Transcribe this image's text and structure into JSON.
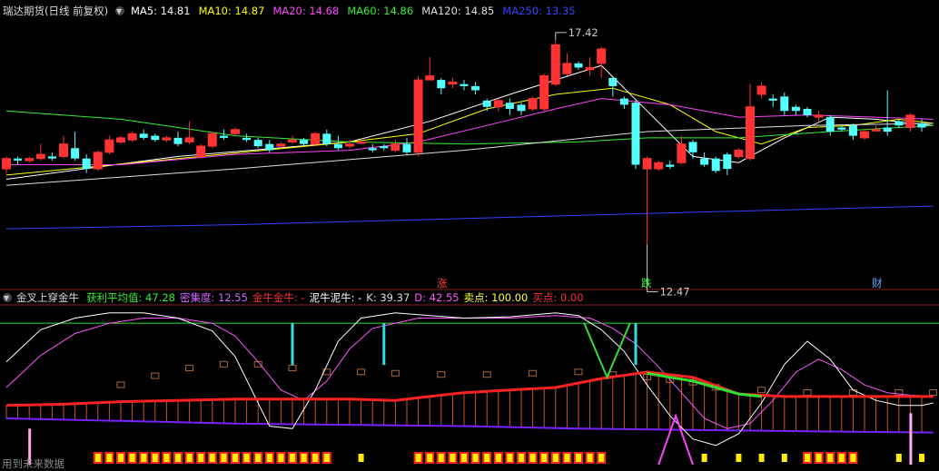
{
  "main": {
    "title": "瑞达期货(日线 前复权)",
    "ma_legend": [
      {
        "label": "MA5: 14.81",
        "color": "#ffffff"
      },
      {
        "label": "MA10: 14.87",
        "color": "#ffff00"
      },
      {
        "label": "MA20: 14.68",
        "color": "#ff44ff"
      },
      {
        "label": "MA60: 14.86",
        "color": "#33ee33"
      },
      {
        "label": "MA120: 14.85",
        "color": "#dddddd"
      },
      {
        "label": "MA250: 13.35",
        "color": "#3344ff"
      }
    ],
    "high_marker": "17.42",
    "low_marker": "12.47",
    "event_labels": [
      {
        "text": "涨",
        "color": "#ff4444"
      },
      {
        "text": "跌",
        "color": "#44ff44"
      },
      {
        "text": "财",
        "color": "#66aaff"
      }
    ]
  },
  "indicator": {
    "title": "金叉上穿金牛",
    "legend": [
      {
        "label": "获利平均值: 47.28",
        "color": "#33ee33"
      },
      {
        "label": "密集度: 12.55",
        "color": "#cc66ff"
      },
      {
        "label": "金牛金牛: -",
        "color": "#ff3333"
      },
      {
        "label": "泥牛泥牛: -",
        "color": "#ffffff"
      },
      {
        "label": "K: 39.37",
        "color": "#dddddd"
      },
      {
        "label": "D: 42.55",
        "color": "#ff55ff"
      },
      {
        "label": "卖点: 100.00",
        "color": "#ffff33"
      },
      {
        "label": "买点: 0.00",
        "color": "#ff3333"
      }
    ],
    "footer": "用到未来数据"
  },
  "chart_data": {
    "type": "candlestick",
    "ylim": [
      11.8,
      17.9
    ],
    "candles": [
      [
        14.3,
        14.55,
        14.2,
        14.6
      ],
      [
        14.55,
        14.5,
        14.4,
        14.6
      ],
      [
        14.5,
        14.55,
        14.45,
        14.6
      ],
      [
        14.55,
        14.65,
        14.5,
        14.9
      ],
      [
        14.6,
        14.55,
        14.5,
        14.7
      ],
      [
        14.6,
        14.9,
        14.55,
        15.1
      ],
      [
        14.8,
        14.55,
        14.5,
        15.2
      ],
      [
        14.55,
        14.3,
        14.2,
        14.65
      ],
      [
        14.3,
        14.7,
        14.25,
        14.75
      ],
      [
        14.7,
        15.0,
        14.65,
        15.1
      ],
      [
        14.95,
        15.05,
        14.9,
        15.1
      ],
      [
        15.0,
        15.15,
        14.95,
        15.2
      ],
      [
        15.15,
        15.05,
        15.0,
        15.25
      ],
      [
        15.1,
        15.0,
        14.95,
        15.15
      ],
      [
        15.0,
        15.05,
        14.95,
        15.1
      ],
      [
        15.05,
        14.9,
        14.85,
        15.2
      ],
      [
        14.95,
        15.05,
        14.9,
        15.45
      ],
      [
        14.6,
        14.85,
        14.55,
        14.9
      ],
      [
        14.85,
        15.15,
        14.8,
        15.2
      ],
      [
        15.1,
        15.05,
        15.0,
        15.25
      ],
      [
        15.15,
        15.25,
        15.1,
        15.3
      ],
      [
        15.05,
        15.0,
        14.95,
        15.15
      ],
      [
        15.0,
        14.85,
        14.8,
        15.05
      ],
      [
        14.9,
        14.75,
        14.7,
        15.0
      ],
      [
        14.85,
        14.9,
        14.8,
        14.95
      ],
      [
        14.95,
        15.0,
        14.9,
        15.1
      ],
      [
        15.0,
        14.9,
        14.85,
        15.05
      ],
      [
        14.9,
        15.15,
        14.85,
        15.2
      ],
      [
        15.15,
        14.9,
        14.85,
        15.25
      ],
      [
        14.9,
        14.8,
        14.75,
        15.1
      ],
      [
        14.85,
        14.9,
        14.8,
        15.0
      ],
      [
        14.95,
        14.95,
        14.9,
        15.0
      ],
      [
        14.8,
        14.75,
        14.7,
        14.9
      ],
      [
        14.85,
        14.8,
        14.75,
        14.9
      ],
      [
        14.75,
        14.9,
        14.7,
        15.0
      ],
      [
        14.9,
        14.7,
        14.65,
        15.05
      ],
      [
        14.7,
        16.45,
        14.6,
        16.55
      ],
      [
        16.45,
        16.55,
        16.45,
        17.0
      ],
      [
        16.45,
        16.25,
        16.1,
        16.5
      ],
      [
        16.35,
        16.4,
        16.25,
        16.5
      ],
      [
        16.35,
        16.3,
        16.2,
        16.45
      ],
      [
        16.3,
        16.2,
        16.1,
        16.4
      ],
      [
        15.95,
        15.8,
        15.7,
        16.0
      ],
      [
        15.8,
        15.95,
        15.7,
        16.0
      ],
      [
        15.9,
        15.75,
        15.6,
        16.0
      ],
      [
        15.85,
        15.7,
        15.6,
        15.9
      ],
      [
        15.75,
        16.0,
        15.7,
        16.05
      ],
      [
        15.75,
        16.55,
        15.7,
        16.6
      ],
      [
        16.35,
        17.3,
        16.3,
        17.42
      ],
      [
        16.6,
        16.85,
        16.55,
        17.1
      ],
      [
        16.85,
        16.75,
        16.7,
        16.9
      ],
      [
        16.7,
        16.75,
        16.55,
        17.0
      ],
      [
        16.85,
        17.2,
        16.5,
        17.25
      ],
      [
        16.5,
        16.3,
        16.05,
        16.5
      ],
      [
        16.0,
        15.85,
        15.75,
        16.05
      ],
      [
        15.9,
        14.4,
        14.3,
        15.95
      ],
      [
        14.3,
        14.55,
        12.47,
        14.6
      ],
      [
        14.3,
        14.45,
        14.25,
        14.5
      ],
      [
        14.4,
        14.35,
        14.3,
        14.5
      ],
      [
        14.45,
        14.9,
        14.4,
        15.1
      ],
      [
        14.95,
        14.7,
        14.55,
        15.0
      ],
      [
        14.55,
        14.4,
        14.35,
        14.7
      ],
      [
        14.55,
        14.25,
        14.2,
        14.6
      ],
      [
        14.65,
        14.3,
        14.15,
        14.7
      ],
      [
        14.6,
        14.75,
        14.55,
        14.8
      ],
      [
        14.55,
        15.8,
        14.5,
        16.35
      ],
      [
        16.1,
        16.3,
        16.0,
        16.4
      ],
      [
        16.0,
        15.95,
        15.8,
        16.1
      ],
      [
        16.05,
        15.7,
        15.6,
        16.15
      ],
      [
        15.8,
        15.7,
        15.6,
        15.85
      ],
      [
        15.75,
        15.6,
        15.55,
        15.8
      ],
      [
        15.55,
        15.6,
        15.45,
        15.7
      ],
      [
        15.55,
        15.2,
        15.1,
        15.6
      ],
      [
        15.3,
        15.25,
        15.2,
        15.35
      ],
      [
        15.35,
        15.1,
        15.0,
        15.4
      ],
      [
        15.05,
        15.2,
        15.0,
        15.25
      ],
      [
        15.25,
        15.25,
        15.2,
        15.35
      ],
      [
        15.3,
        15.2,
        15.1,
        16.2
      ],
      [
        15.45,
        15.35,
        15.3,
        15.5
      ],
      [
        15.3,
        15.6,
        15.2,
        15.65
      ],
      [
        15.4,
        15.3,
        15.2,
        15.5
      ]
    ],
    "ma_series": [
      {
        "name": "MA5",
        "color": "#ffffff",
        "points": [
          [
            0,
            14.05
          ],
          [
            15,
            14.6
          ],
          [
            30,
            14.95
          ],
          [
            37,
            15.45
          ],
          [
            44,
            16.1
          ],
          [
            48,
            16.45
          ],
          [
            52,
            16.8
          ],
          [
            56,
            15.7
          ],
          [
            60,
            14.6
          ],
          [
            64,
            14.45
          ],
          [
            68,
            15.05
          ],
          [
            72,
            15.55
          ],
          [
            76,
            15.5
          ],
          [
            81,
            15.35
          ]
        ]
      },
      {
        "name": "MA10",
        "color": "#ffff00",
        "points": [
          [
            0,
            14.15
          ],
          [
            15,
            14.55
          ],
          [
            30,
            14.95
          ],
          [
            36,
            15.15
          ],
          [
            42,
            15.75
          ],
          [
            48,
            16.1
          ],
          [
            53,
            16.25
          ],
          [
            58,
            15.85
          ],
          [
            62,
            15.2
          ],
          [
            66,
            14.9
          ],
          [
            70,
            15.3
          ],
          [
            74,
            15.35
          ],
          [
            78,
            15.5
          ],
          [
            81,
            15.4
          ]
        ]
      },
      {
        "name": "MA20",
        "color": "#ff44ff",
        "points": [
          [
            0,
            14.4
          ],
          [
            10,
            14.4
          ],
          [
            20,
            14.65
          ],
          [
            30,
            14.75
          ],
          [
            36,
            14.95
          ],
          [
            42,
            15.35
          ],
          [
            48,
            15.75
          ],
          [
            52,
            16.0
          ],
          [
            58,
            15.85
          ],
          [
            64,
            15.55
          ],
          [
            70,
            15.6
          ],
          [
            76,
            15.55
          ],
          [
            81,
            15.5
          ]
        ]
      },
      {
        "name": "MA60",
        "color": "#33ee33",
        "points": [
          [
            0,
            15.7
          ],
          [
            10,
            15.5
          ],
          [
            20,
            15.1
          ],
          [
            30,
            14.95
          ],
          [
            40,
            14.9
          ],
          [
            50,
            14.95
          ],
          [
            56,
            15.05
          ],
          [
            64,
            15.05
          ],
          [
            72,
            15.2
          ],
          [
            81,
            15.35
          ]
        ]
      },
      {
        "name": "MA120",
        "color": "#dddddd",
        "points": [
          [
            0,
            13.9
          ],
          [
            20,
            14.3
          ],
          [
            40,
            14.75
          ],
          [
            56,
            15.2
          ],
          [
            70,
            15.35
          ],
          [
            81,
            15.4
          ]
        ]
      },
      {
        "name": "MA250",
        "color": "#3344ff",
        "points": [
          [
            0,
            12.85
          ],
          [
            20,
            12.95
          ],
          [
            40,
            13.1
          ],
          [
            60,
            13.25
          ],
          [
            81,
            13.4
          ]
        ]
      }
    ],
    "indicator": {
      "ylim": [
        -10,
        110
      ],
      "k_line": [
        [
          0,
          70
        ],
        [
          3,
          95
        ],
        [
          6,
          104
        ],
        [
          9,
          108
        ],
        [
          12,
          108
        ],
        [
          15,
          104
        ],
        [
          18,
          94
        ],
        [
          20,
          74
        ],
        [
          22,
          38
        ],
        [
          23,
          20
        ],
        [
          25,
          18
        ],
        [
          27,
          48
        ],
        [
          29,
          86
        ],
        [
          31,
          104
        ],
        [
          34,
          108
        ],
        [
          37,
          106
        ],
        [
          40,
          104
        ],
        [
          44,
          105
        ],
        [
          48,
          108
        ],
        [
          50,
          106
        ],
        [
          52,
          95
        ],
        [
          54,
          78
        ],
        [
          56,
          52
        ],
        [
          58,
          28
        ],
        [
          60,
          10
        ],
        [
          62,
          5
        ],
        [
          64,
          14
        ],
        [
          66,
          38
        ],
        [
          68,
          68
        ],
        [
          70,
          86
        ],
        [
          72,
          72
        ],
        [
          74,
          48
        ],
        [
          76,
          40
        ],
        [
          78,
          36
        ],
        [
          80,
          36
        ],
        [
          81,
          38
        ]
      ],
      "d_line": [
        [
          0,
          50
        ],
        [
          3,
          75
        ],
        [
          6,
          92
        ],
        [
          9,
          100
        ],
        [
          12,
          104
        ],
        [
          15,
          104
        ],
        [
          18,
          100
        ],
        [
          20,
          90
        ],
        [
          22,
          70
        ],
        [
          24,
          48
        ],
        [
          26,
          40
        ],
        [
          28,
          55
        ],
        [
          30,
          80
        ],
        [
          32,
          96
        ],
        [
          36,
          104
        ],
        [
          40,
          104
        ],
        [
          44,
          104
        ],
        [
          48,
          106
        ],
        [
          51,
          104
        ],
        [
          53,
          96
        ],
        [
          55,
          84
        ],
        [
          57,
          66
        ],
        [
          59,
          46
        ],
        [
          61,
          26
        ],
        [
          63,
          18
        ],
        [
          65,
          22
        ],
        [
          67,
          40
        ],
        [
          69,
          62
        ],
        [
          71,
          72
        ],
        [
          73,
          64
        ],
        [
          75,
          52
        ],
        [
          77,
          46
        ],
        [
          79,
          44
        ],
        [
          81,
          43
        ]
      ],
      "red_line": [
        [
          0,
          36
        ],
        [
          5,
          37
        ],
        [
          10,
          39
        ],
        [
          15,
          40
        ],
        [
          20,
          41
        ],
        [
          25,
          41
        ],
        [
          30,
          41
        ],
        [
          34,
          40
        ],
        [
          36,
          42
        ],
        [
          40,
          46
        ],
        [
          44,
          48
        ],
        [
          48,
          50
        ],
        [
          52,
          57
        ],
        [
          56,
          62
        ],
        [
          60,
          58
        ],
        [
          64,
          45
        ],
        [
          68,
          43
        ],
        [
          72,
          43
        ],
        [
          76,
          43
        ],
        [
          81,
          43
        ]
      ],
      "green_segment": [
        [
          56,
          61
        ],
        [
          58,
          58
        ],
        [
          60,
          55
        ],
        [
          62,
          50
        ],
        [
          64,
          45
        ],
        [
          66,
          43
        ]
      ],
      "purple_line": [
        [
          0,
          26
        ],
        [
          10,
          24
        ],
        [
          20,
          22
        ],
        [
          30,
          21
        ],
        [
          40,
          20
        ],
        [
          50,
          18
        ],
        [
          60,
          17
        ],
        [
          70,
          16
        ],
        [
          81,
          15
        ]
      ],
      "open_bars": [
        [
          10,
          50
        ],
        [
          13,
          57
        ],
        [
          16,
          63
        ],
        [
          19,
          66
        ],
        [
          22,
          66
        ],
        [
          25,
          63
        ],
        [
          28,
          60
        ],
        [
          31,
          60
        ],
        [
          34,
          59
        ],
        [
          38,
          58
        ],
        [
          42,
          58
        ],
        [
          46,
          59
        ],
        [
          50,
          60
        ],
        [
          53,
          58
        ],
        [
          56,
          56
        ],
        [
          58,
          54
        ],
        [
          60,
          52
        ],
        [
          62,
          48
        ],
        [
          66,
          46
        ],
        [
          70,
          44
        ],
        [
          74,
          44
        ],
        [
          78,
          44
        ],
        [
          81,
          44
        ]
      ],
      "cyan_spikes": [
        25,
        33,
        55
      ],
      "buy_markers": [
        8,
        9,
        10,
        11,
        12,
        13,
        14,
        15,
        16,
        17,
        18,
        19,
        20,
        21,
        22,
        23,
        24,
        25,
        26,
        27,
        28,
        36,
        37,
        38,
        39,
        40,
        41,
        42,
        43,
        44,
        45,
        46,
        47,
        48,
        49,
        50,
        51,
        52,
        70,
        71,
        72,
        73,
        74
      ]
    }
  }
}
